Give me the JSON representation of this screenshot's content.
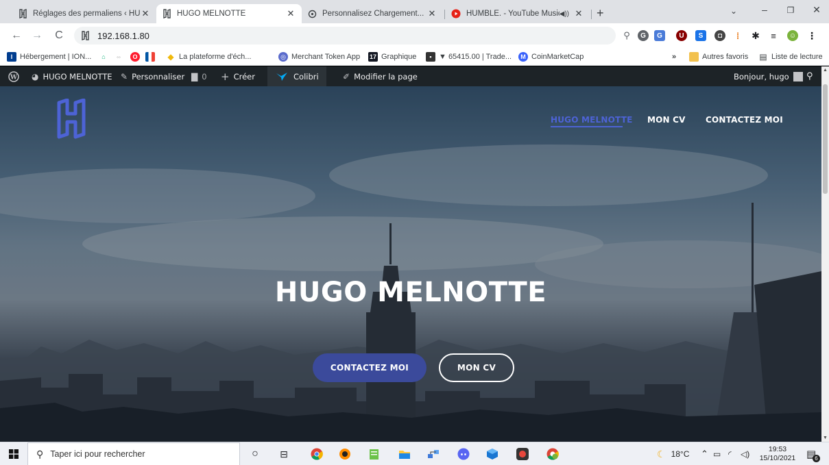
{
  "browser": {
    "tabs": [
      {
        "title": "Réglages des permaliens ‹ HUGO",
        "active": false
      },
      {
        "title": "HUGO MELNOTTE",
        "active": true
      },
      {
        "title": "Personnalisez Chargement...",
        "active": false
      },
      {
        "title": "HUMBLE. - YouTube Music",
        "active": false
      }
    ],
    "new_tab": "+",
    "address": "192.168.1.80",
    "bookmarks": [
      {
        "label": "Hébergement | ION..."
      },
      {
        "label": "La plateforme d'éch..."
      },
      {
        "label": "Merchant Token App"
      },
      {
        "label": "Graphique"
      },
      {
        "label": "▼ 65415.00 | Trade..."
      },
      {
        "label": "CoinMarketCap"
      }
    ],
    "bookmarks_more": "»",
    "other_favorites": "Autres favoris",
    "reading_list": "Liste de lecture"
  },
  "wp_admin": {
    "site_name": "HUGO MELNOTTE",
    "customize": "Personnaliser",
    "comments_count": "0",
    "create": "Créer",
    "colibri": "Colibri",
    "edit_page": "Modifier la page",
    "greeting": "Bonjour, hugo"
  },
  "site": {
    "menu": [
      {
        "label": "HUGO MELNOTTE",
        "current": true
      },
      {
        "label": "MON CV",
        "current": false
      },
      {
        "label": "CONTACTEZ MOI",
        "current": false
      }
    ],
    "hero_title": "HUGO MELNOTTE",
    "primary_button": "CONTACTEZ MOI",
    "secondary_button": "MON CV",
    "accent_color": "#4d63d6",
    "button_color": "#3b4a9b"
  },
  "taskbar": {
    "search_placeholder": "Taper ici pour rechercher",
    "temperature": "18°C",
    "time": "19:53",
    "date": "15/10/2021",
    "notifications": "6"
  }
}
